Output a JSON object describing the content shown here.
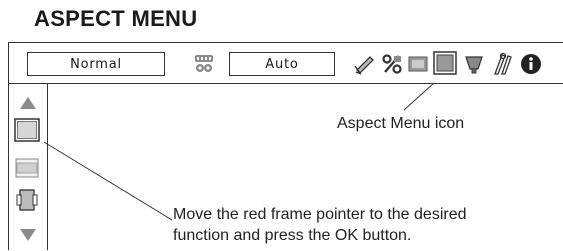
{
  "title": "ASPECT MENU",
  "menu_bar": {
    "mode_value": "Normal",
    "auto_value": "Auto"
  },
  "icons": [
    "settings-block-icon",
    "pc-adjust-icon",
    "percent-icon",
    "image-icon",
    "aspect-menu-icon",
    "color-icon",
    "tools-icon",
    "info-icon"
  ],
  "sidebar_icons": [
    "up-arrow-icon",
    "aspect-normal-icon",
    "aspect-wide-icon",
    "aspect-zoom-icon",
    "down-arrow-icon"
  ],
  "callouts": {
    "aspect_menu_icon": "Aspect Menu icon",
    "instruction_line1": "Move the red frame pointer to the desired",
    "instruction_line2": "function and press the OK  button."
  },
  "colors": {
    "line": "#333333",
    "icon_gray": "#8a8a8a",
    "highlight": "#e5e5e5"
  }
}
